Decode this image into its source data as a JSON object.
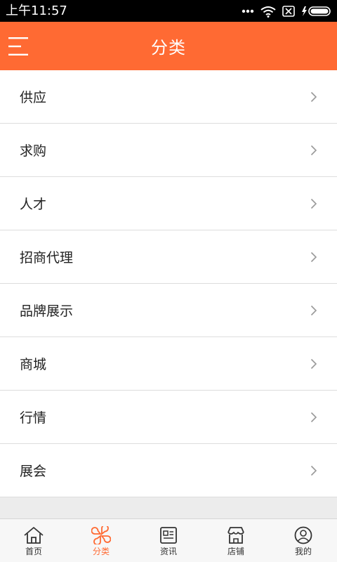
{
  "status_bar": {
    "time": "上午11:57"
  },
  "header": {
    "title": "分类",
    "menu_icon": "menu-icon"
  },
  "categories": [
    {
      "label": "供应"
    },
    {
      "label": "求购"
    },
    {
      "label": "人才"
    },
    {
      "label": "招商代理"
    },
    {
      "label": "品牌展示"
    },
    {
      "label": "商城"
    },
    {
      "label": "行情"
    },
    {
      "label": "展会"
    }
  ],
  "tabbar": {
    "active_color": "#ff6a33",
    "items": [
      {
        "label": "首页",
        "icon": "home-icon"
      },
      {
        "label": "分类",
        "icon": "category-icon",
        "active": true
      },
      {
        "label": "资讯",
        "icon": "news-icon"
      },
      {
        "label": "店铺",
        "icon": "store-icon"
      },
      {
        "label": "我的",
        "icon": "profile-icon"
      }
    ]
  },
  "colors": {
    "brand": "#ff6a33",
    "background": "#ececec"
  }
}
